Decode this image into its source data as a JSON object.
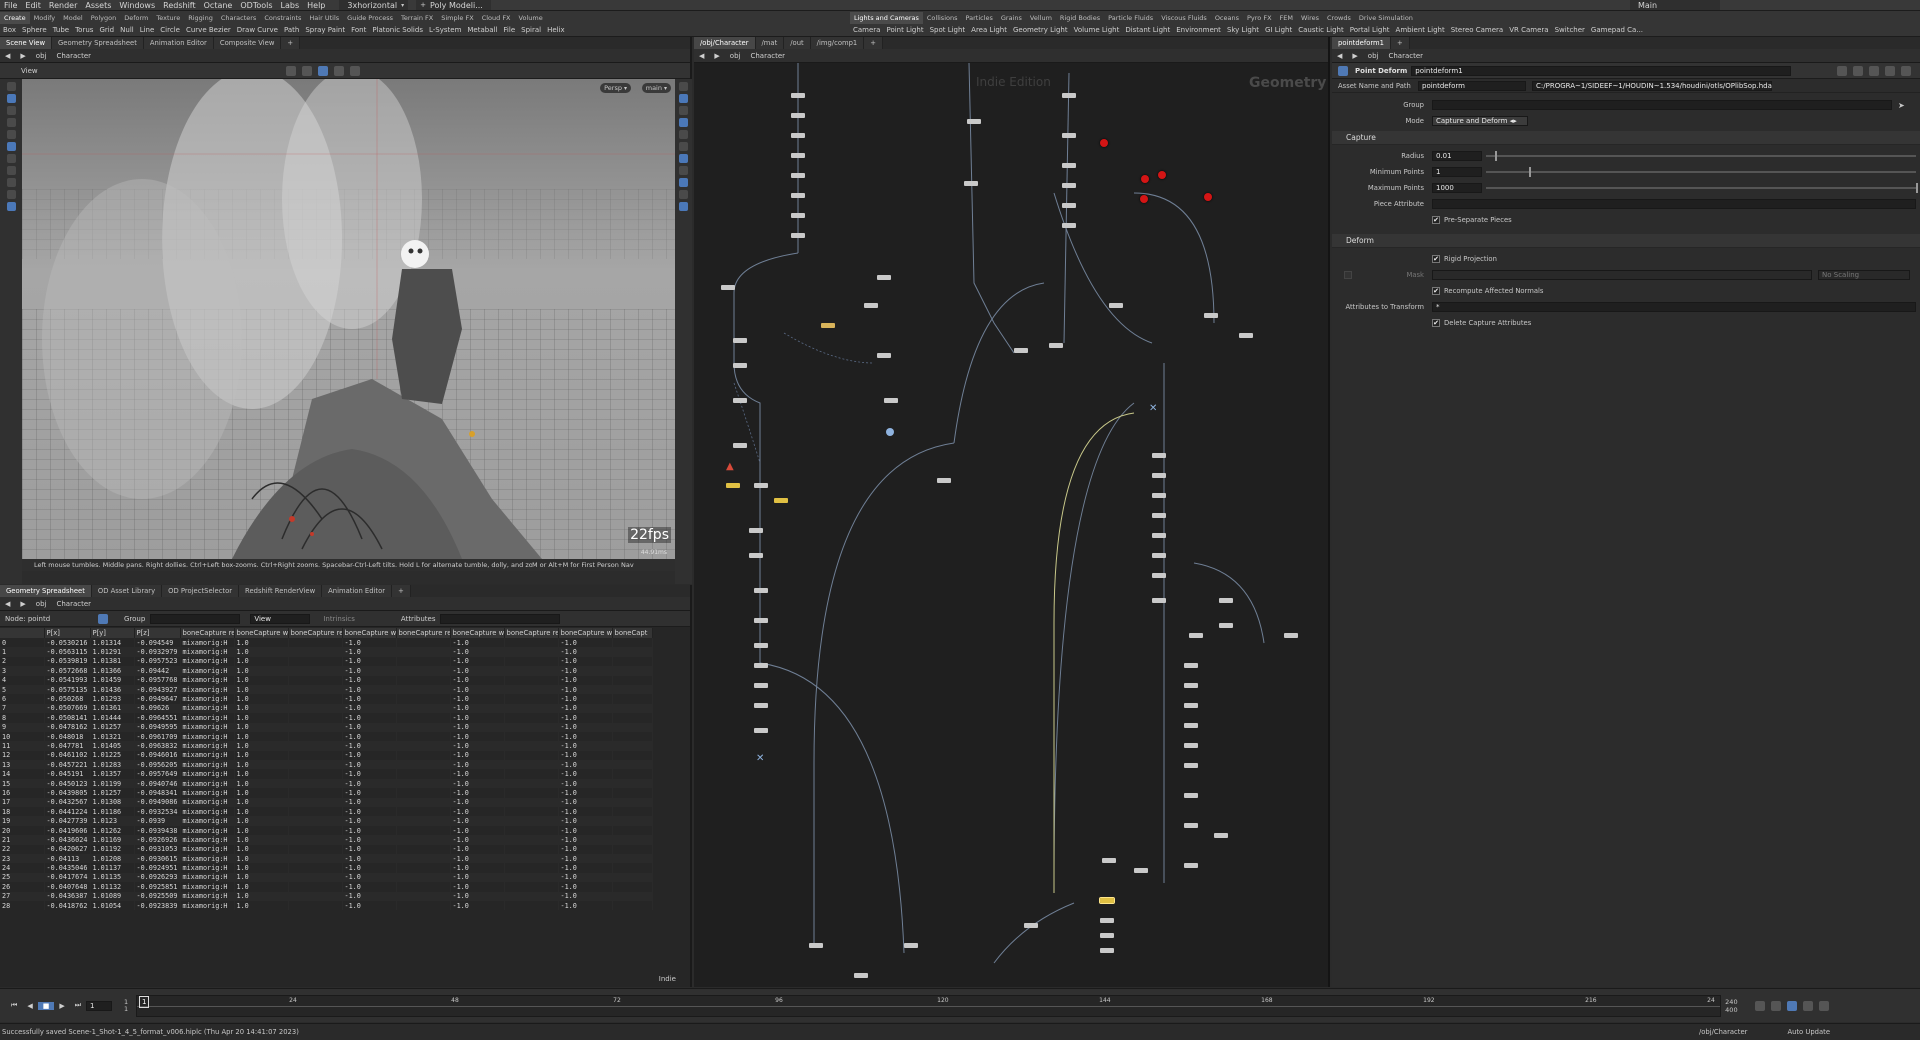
{
  "menubar": {
    "items": [
      "File",
      "Edit",
      "Render",
      "Assets",
      "Windows",
      "Redshift",
      "Octane",
      "ODTools",
      "Labs",
      "Help"
    ],
    "desktop": "3xhorizontal",
    "shelf_set": "Poly Modeli...",
    "workspace": "Main"
  },
  "shelf_left": {
    "tabs": [
      "Create",
      "Modify",
      "Model",
      "Polygon",
      "Deform",
      "Texture",
      "Rigging",
      "Characters",
      "Constraints",
      "Hair Utils",
      "Guide Process",
      "Terrain FX",
      "Simple FX",
      "Cloud FX",
      "Volume"
    ],
    "tools": [
      "Box",
      "Sphere",
      "Tube",
      "Torus",
      "Grid",
      "Null",
      "Line",
      "Circle",
      "Curve Bezier",
      "Draw Curve",
      "Path",
      "Spray Paint",
      "Font",
      "Platonic Solids",
      "L-System",
      "Metaball",
      "File",
      "Spiral",
      "Helix"
    ]
  },
  "shelf_right": {
    "tabs": [
      "Lights and Cameras",
      "Collisions",
      "Particles",
      "Grains",
      "Vellum",
      "Rigid Bodies",
      "Particle Fluids",
      "Viscous Fluids",
      "Oceans",
      "Pyro FX",
      "FEM",
      "Wires",
      "Crowds",
      "Drive Simulation"
    ],
    "tools": [
      "Camera",
      "Point Light",
      "Spot Light",
      "Area Light",
      "Geometry Light",
      "Volume Light",
      "Distant Light",
      "Environment",
      "Sky Light",
      "GI Light",
      "Caustic Light",
      "Portal Light",
      "Ambient Light",
      "Stereo Camera",
      "VR Camera",
      "Switcher",
      "Gamepad Ca..."
    ]
  },
  "left_top": {
    "tabs": [
      "Scene View",
      "Geometry Spreadsheet",
      "Animation Editor",
      "Composite View"
    ],
    "path": [
      "obj",
      "Character"
    ],
    "viewport_label": "View",
    "persp": "Persp",
    "cam": "main",
    "fps": "22fps",
    "fps_sub": "44.91ms",
    "hint": "Left mouse tumbles. Middle pans. Right dollies. Ctrl+Left box-zooms. Ctrl+Right zooms. Spacebar-Ctrl-Left tilts. Hold L for alternate tumble, dolly, and zoom.",
    "hint2": "M or Alt+M for First Person Nav"
  },
  "left_bottom": {
    "tabs": [
      "Geometry Spreadsheet",
      "OD Asset Library",
      "OD ProjectSelector",
      "Redshift RenderView",
      "Animation Editor"
    ],
    "path": [
      "obj",
      "Character"
    ],
    "node_label": "Node: pointd",
    "group_label": "Group",
    "view_label": "View",
    "intrinsics_label": "Intrinsics",
    "attributes_label": "Attributes",
    "footer": "Indie",
    "columns": [
      "",
      "P[x]",
      "P[y]",
      "P[z]",
      "boneCapture re",
      "boneCapture w",
      "boneCapture re",
      "boneCapture w",
      "boneCapture re",
      "boneCapture w",
      "boneCapture re",
      "boneCapture w",
      "boneCapt"
    ],
    "rows": [
      [
        "0",
        "-0.0530216",
        "1.01314",
        "-0.094549",
        "mixamorig:H",
        "1.0",
        "",
        "-1.0",
        "",
        "-1.0",
        "",
        "-1.0",
        ""
      ],
      [
        "1",
        "-0.0563115",
        "1.01291",
        "-0.0932979",
        "mixamorig:H",
        "1.0",
        "",
        "-1.0",
        "",
        "-1.0",
        "",
        "-1.0",
        ""
      ],
      [
        "2",
        "-0.0539819",
        "1.01381",
        "-0.0957523",
        "mixamorig:H",
        "1.0",
        "",
        "-1.0",
        "",
        "-1.0",
        "",
        "-1.0",
        ""
      ],
      [
        "3",
        "-0.0572668",
        "1.01366",
        "-0.09442",
        "mixamorig:H",
        "1.0",
        "",
        "-1.0",
        "",
        "-1.0",
        "",
        "-1.0",
        ""
      ],
      [
        "4",
        "-0.0541993",
        "1.01459",
        "-0.0957768",
        "mixamorig:H",
        "1.0",
        "",
        "-1.0",
        "",
        "-1.0",
        "",
        "-1.0",
        ""
      ],
      [
        "5",
        "-0.0575135",
        "1.01436",
        "-0.0943927",
        "mixamorig:H",
        "1.0",
        "",
        "-1.0",
        "",
        "-1.0",
        "",
        "-1.0",
        ""
      ],
      [
        "6",
        "-0.050268",
        "1.01293",
        "-0.0949647",
        "mixamorig:H",
        "1.0",
        "",
        "-1.0",
        "",
        "-1.0",
        "",
        "-1.0",
        ""
      ],
      [
        "7",
        "-0.0507669",
        "1.01361",
        "-0.09626",
        "mixamorig:H",
        "1.0",
        "",
        "-1.0",
        "",
        "-1.0",
        "",
        "-1.0",
        ""
      ],
      [
        "8",
        "-0.0508141",
        "1.01444",
        "-0.0964551",
        "mixamorig:H",
        "1.0",
        "",
        "-1.0",
        "",
        "-1.0",
        "",
        "-1.0",
        ""
      ],
      [
        "9",
        "-0.0478162",
        "1.01257",
        "-0.0949595",
        "mixamorig:H",
        "1.0",
        "",
        "-1.0",
        "",
        "-1.0",
        "",
        "-1.0",
        ""
      ],
      [
        "10",
        "-0.048018",
        "1.01321",
        "-0.0961709",
        "mixamorig:H",
        "1.0",
        "",
        "-1.0",
        "",
        "-1.0",
        "",
        "-1.0",
        ""
      ],
      [
        "11",
        "-0.047781",
        "1.01405",
        "-0.0963832",
        "mixamorig:H",
        "1.0",
        "",
        "-1.0",
        "",
        "-1.0",
        "",
        "-1.0",
        ""
      ],
      [
        "12",
        "-0.0461102",
        "1.01225",
        "-0.0946016",
        "mixamorig:H",
        "1.0",
        "",
        "-1.0",
        "",
        "-1.0",
        "",
        "-1.0",
        ""
      ],
      [
        "13",
        "-0.0457221",
        "1.01283",
        "-0.0956205",
        "mixamorig:H",
        "1.0",
        "",
        "-1.0",
        "",
        "-1.0",
        "",
        "-1.0",
        ""
      ],
      [
        "14",
        "-0.045191",
        "1.01357",
        "-0.0957649",
        "mixamorig:H",
        "1.0",
        "",
        "-1.0",
        "",
        "-1.0",
        "",
        "-1.0",
        ""
      ],
      [
        "15",
        "-0.0450123",
        "1.01199",
        "-0.0940746",
        "mixamorig:H",
        "1.0",
        "",
        "-1.0",
        "",
        "-1.0",
        "",
        "-1.0",
        ""
      ],
      [
        "16",
        "-0.0439805",
        "1.01257",
        "-0.0948341",
        "mixamorig:H",
        "1.0",
        "",
        "-1.0",
        "",
        "-1.0",
        "",
        "-1.0",
        ""
      ],
      [
        "17",
        "-0.0432567",
        "1.01308",
        "-0.0949086",
        "mixamorig:H",
        "1.0",
        "",
        "-1.0",
        "",
        "-1.0",
        "",
        "-1.0",
        ""
      ],
      [
        "18",
        "-0.0441224",
        "1.01186",
        "-0.0932534",
        "mixamorig:H",
        "1.0",
        "",
        "-1.0",
        "",
        "-1.0",
        "",
        "-1.0",
        ""
      ],
      [
        "19",
        "-0.0427739",
        "1.0123",
        "-0.0939",
        "mixamorig:H",
        "1.0",
        "",
        "-1.0",
        "",
        "-1.0",
        "",
        "-1.0",
        ""
      ],
      [
        "20",
        "-0.0419606",
        "1.01262",
        "-0.0939438",
        "mixamorig:H",
        "1.0",
        "",
        "-1.0",
        "",
        "-1.0",
        "",
        "-1.0",
        ""
      ],
      [
        "21",
        "-0.0436024",
        "1.01169",
        "-0.0926926",
        "mixamorig:H",
        "1.0",
        "",
        "-1.0",
        "",
        "-1.0",
        "",
        "-1.0",
        ""
      ],
      [
        "22",
        "-0.0420627",
        "1.01192",
        "-0.0931053",
        "mixamorig:H",
        "1.0",
        "",
        "-1.0",
        "",
        "-1.0",
        "",
        "-1.0",
        ""
      ],
      [
        "23",
        "-0.04113",
        "1.01208",
        "-0.0930615",
        "mixamorig:H",
        "1.0",
        "",
        "-1.0",
        "",
        "-1.0",
        "",
        "-1.0",
        ""
      ],
      [
        "24",
        "-0.0435046",
        "1.01137",
        "-0.0924951",
        "mixamorig:H",
        "1.0",
        "",
        "-1.0",
        "",
        "-1.0",
        "",
        "-1.0",
        ""
      ],
      [
        "25",
        "-0.0417674",
        "1.01135",
        "-0.0926293",
        "mixamorig:H",
        "1.0",
        "",
        "-1.0",
        "",
        "-1.0",
        "",
        "-1.0",
        ""
      ],
      [
        "26",
        "-0.0407648",
        "1.01132",
        "-0.0925851",
        "mixamorig:H",
        "1.0",
        "",
        "-1.0",
        "",
        "-1.0",
        "",
        "-1.0",
        ""
      ],
      [
        "27",
        "-0.0436387",
        "1.01089",
        "-0.0925509",
        "mixamorig:H",
        "1.0",
        "",
        "-1.0",
        "",
        "-1.0",
        "",
        "-1.0",
        ""
      ],
      [
        "28",
        "-0.0418762",
        "1.01054",
        "-0.0923839",
        "mixamorig:H",
        "1.0",
        "",
        "-1.0",
        "",
        "-1.0",
        "",
        "-1.0",
        ""
      ]
    ]
  },
  "center": {
    "tabs": [
      "/obj/Character",
      "/mat",
      "/out",
      "/img/comp1"
    ],
    "path": [
      "obj",
      "Character"
    ],
    "watermark_edition": "Indie Edition",
    "watermark_context": "Geometry"
  },
  "right": {
    "tabs": [
      "Point Deform",
      "pointdeform1"
    ],
    "path": [
      "obj",
      "Character"
    ],
    "node_type": "Point Deform",
    "node_name": "pointdeform1",
    "asset_label": "Asset Name and Path",
    "asset_name": "pointdeform",
    "asset_path": "C:/PROGRA~1/SIDEEF~1/HOUDIN~1.534/houdini/otls/OPlibSop.hda",
    "group_label": "Group",
    "mode_label": "Mode",
    "mode_value": "Capture and Deform",
    "capture_section": "Capture",
    "radius_label": "Radius",
    "radius_value": "0.01",
    "radius_fraction": 0.02,
    "minpts_label": "Minimum Points",
    "minpts_value": "1",
    "minpts_fraction": 0.1,
    "maxpts_label": "Maximum Points",
    "maxpts_value": "1000",
    "maxpts_fraction": 1.0,
    "piece_label": "Piece Attribute",
    "preseparate_label": "Pre-Separate Pieces",
    "deform_section": "Deform",
    "rigid_label": "Rigid Projection",
    "mask_label": "Mask",
    "noscaling_label": "No Scaling",
    "recompute_label": "Recompute Affected Normals",
    "attrs_label": "Attributes to Transform",
    "attrs_value": "*",
    "delete_label": "Delete Capture Attributes",
    "check_mark": "✔"
  },
  "timeline": {
    "current_frame": "1",
    "start": "1",
    "start2": "1",
    "ticks": [
      "24",
      "48",
      "72",
      "96",
      "120",
      "144",
      "168",
      "192",
      "216",
      "24"
    ],
    "end_top": "240",
    "end_bottom": "400",
    "auto_update": "Auto Update"
  },
  "status": {
    "message": "Successfully saved Scene-1_Shot-1_4_5_format_v006.hiplc (Thu Apr 20 14:41:07 2023)",
    "obj_path": "/obj/Character"
  },
  "colors": {
    "node_error_red": "#d41515",
    "accent_blue": "#4f79b5"
  }
}
